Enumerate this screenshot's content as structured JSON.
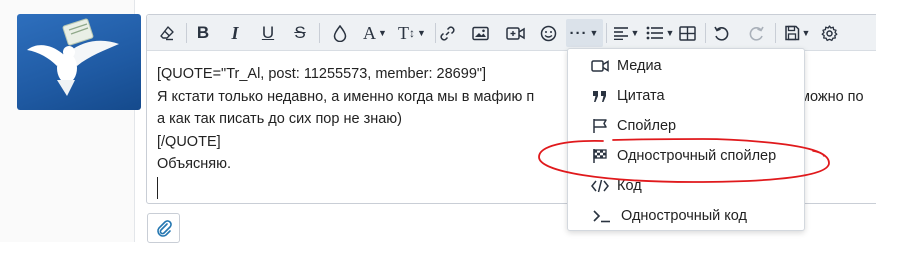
{
  "editor": {
    "lines": [
      "[QUOTE=\"Tr_Al, post: 11255573, member: 28699\"]",
      "Я кстати только недавно, а именно когда мы в мафию п",
      "а как так писать до сих пор не знаю)",
      "[/QUOTE]",
      "Объясняю."
    ],
    "line2_overflow": "можно по"
  },
  "menu": {
    "items": [
      {
        "label": "Медиа",
        "icon": "media-icon"
      },
      {
        "label": "Цитата",
        "icon": "quote-icon"
      },
      {
        "label": "Спойлер",
        "icon": "flag-icon"
      },
      {
        "label": "Однострочный спойлер",
        "icon": "checkered-flag-icon"
      },
      {
        "label": "Код",
        "icon": "code-icon"
      },
      {
        "label": "Однострочный код",
        "icon": "terminal-icon"
      }
    ]
  },
  "colors": {
    "accent": "#2577b1",
    "annotation": "#e0191c",
    "toolbar_bg": "#eef1f4"
  }
}
